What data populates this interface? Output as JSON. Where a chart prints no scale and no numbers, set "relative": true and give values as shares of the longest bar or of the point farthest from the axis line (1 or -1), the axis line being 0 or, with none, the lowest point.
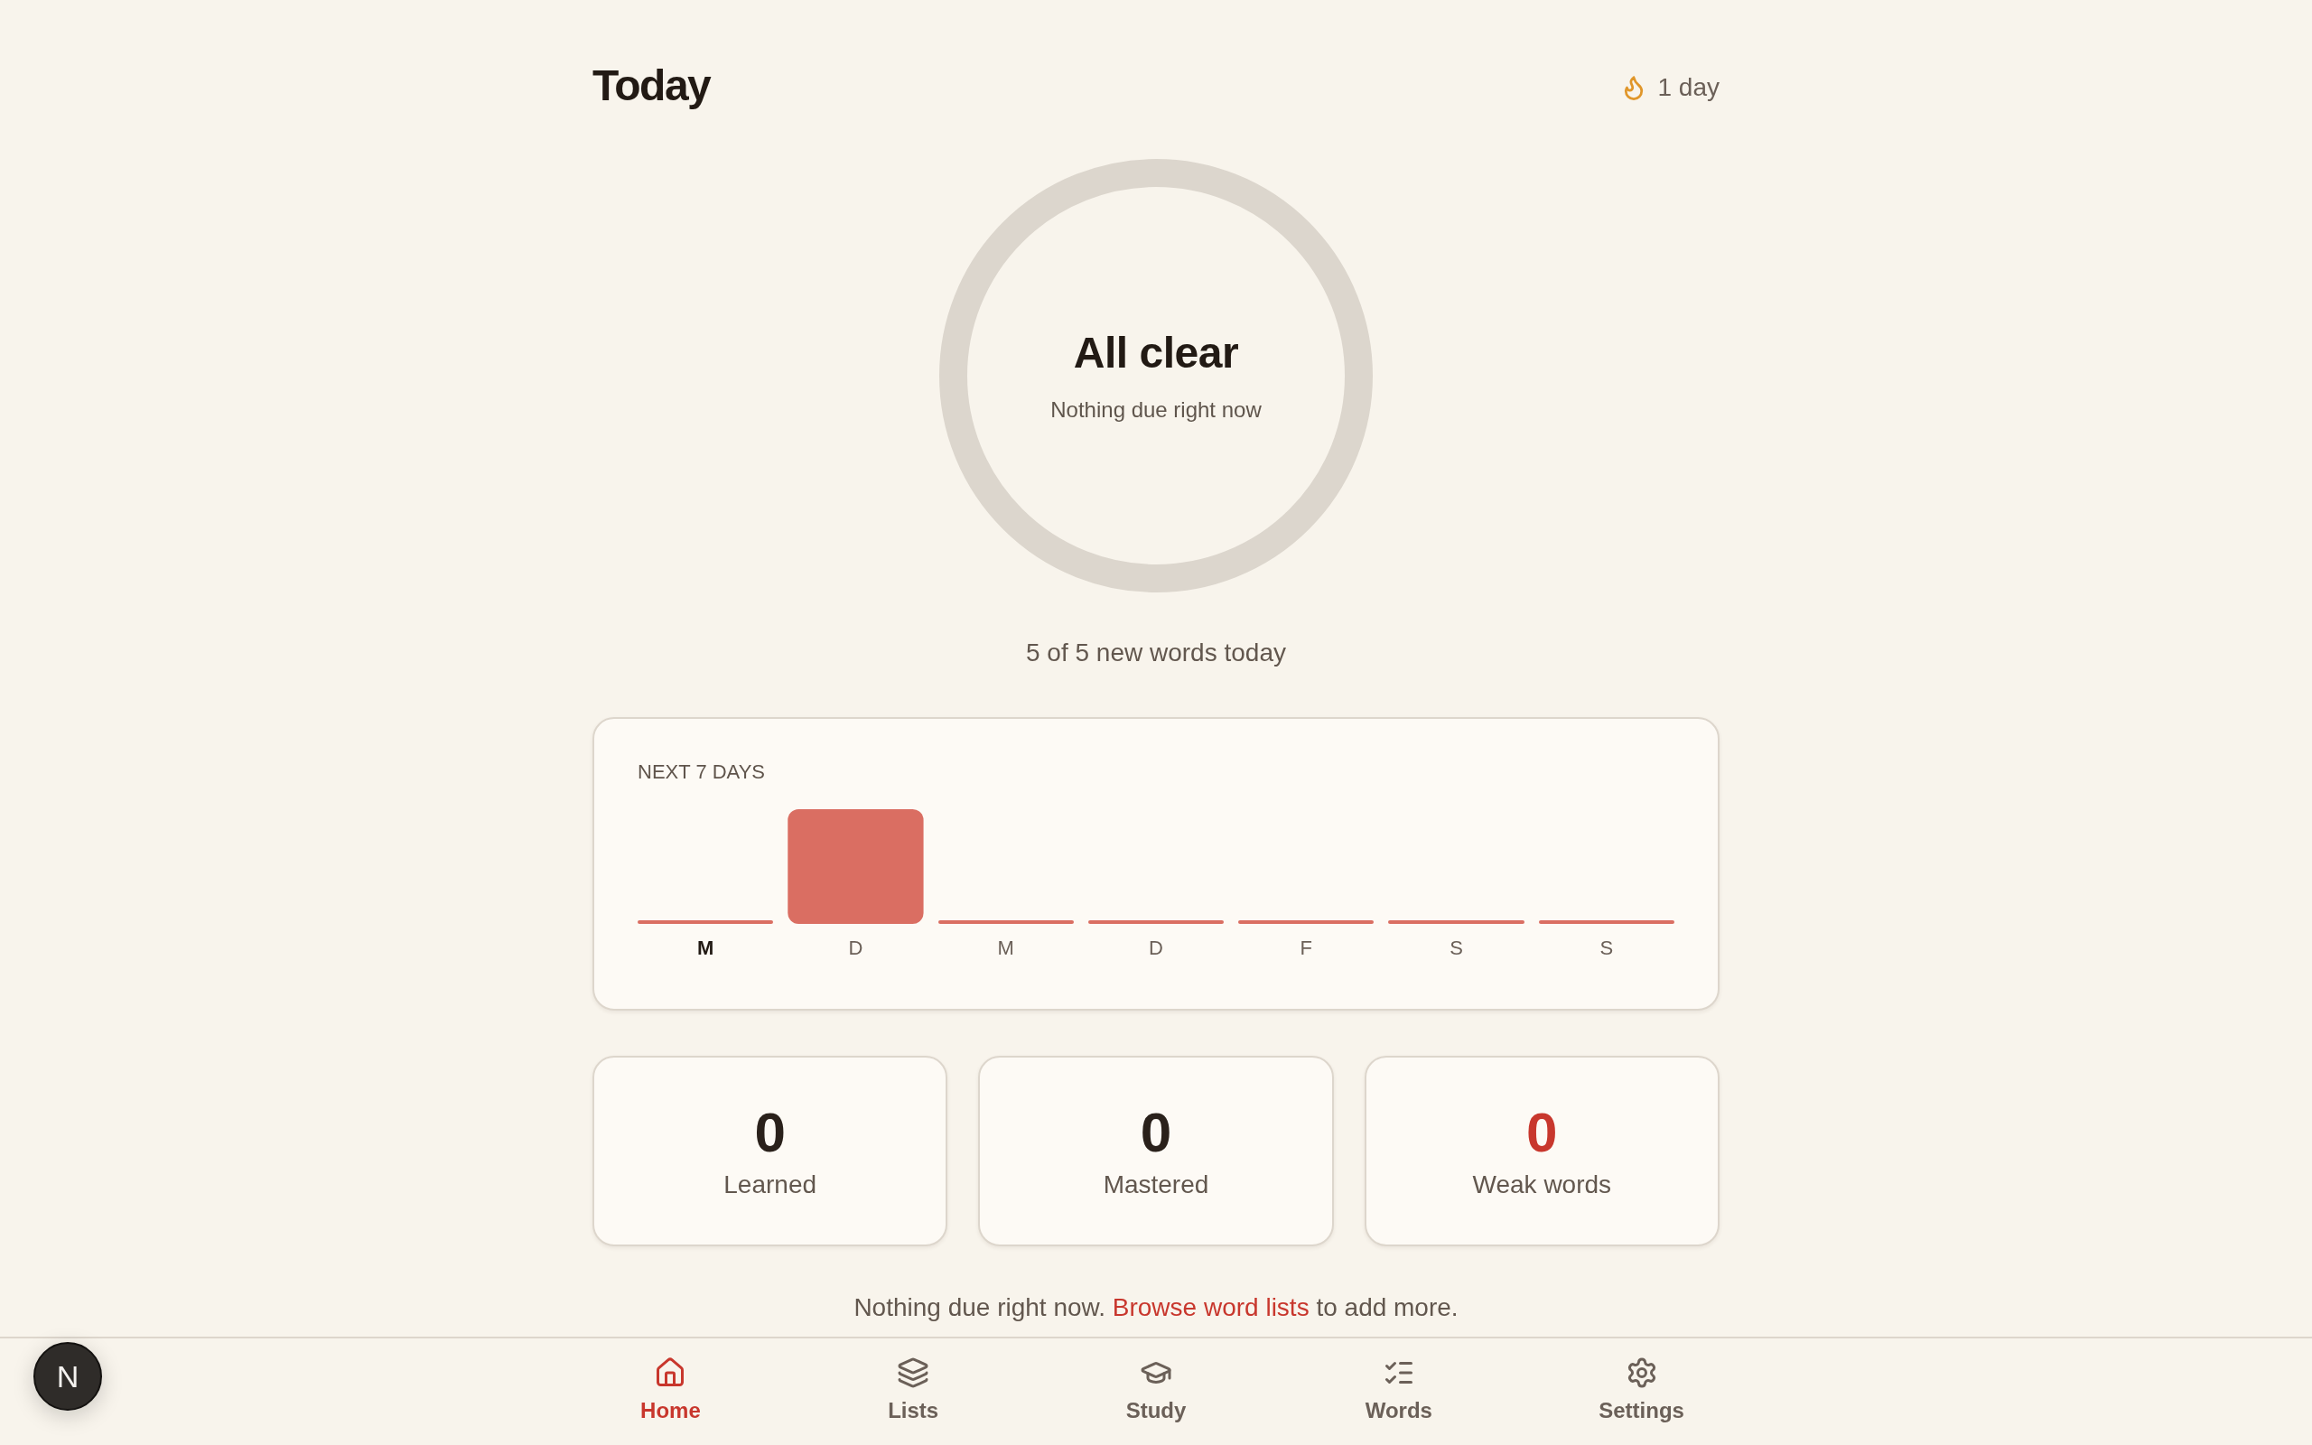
{
  "header": {
    "title": "Today",
    "streak": "1 day"
  },
  "summary": {
    "title": "All clear",
    "subtitle": "Nothing due right now"
  },
  "new_words": "5 of 5 new words today",
  "forecast": {
    "chart_data": {
      "type": "bar",
      "title": "NEXT 7 DAYS",
      "categories": [
        "M",
        "D",
        "M",
        "D",
        "F",
        "S",
        "S"
      ],
      "values": [
        0,
        1,
        0,
        0,
        0,
        0,
        0
      ],
      "relative": true
    },
    "day_states": [
      {
        "selected": true
      },
      {
        "selected": false
      },
      {
        "selected": false
      },
      {
        "selected": false
      },
      {
        "selected": false
      },
      {
        "selected": false
      },
      {
        "selected": false
      }
    ]
  },
  "stats": [
    {
      "value": "0",
      "label": "Learned",
      "kind": "neutral"
    },
    {
      "value": "0",
      "label": "Mastered",
      "kind": "neutral"
    },
    {
      "value": "0",
      "label": "Weak words",
      "kind": "alert"
    }
  ],
  "hint": {
    "text": "Nothing due right now.",
    "link": "Browse word lists",
    "tail": "to add more."
  },
  "nav": [
    {
      "label": "Home",
      "kind": "home",
      "selected": true
    },
    {
      "label": "Lists",
      "kind": "lists",
      "selected": false
    },
    {
      "label": "Study",
      "kind": "study",
      "selected": false
    },
    {
      "label": "Words",
      "kind": "words",
      "selected": false
    },
    {
      "label": "Settings",
      "kind": "settings",
      "selected": false
    }
  ],
  "badge": {
    "label": "N"
  }
}
